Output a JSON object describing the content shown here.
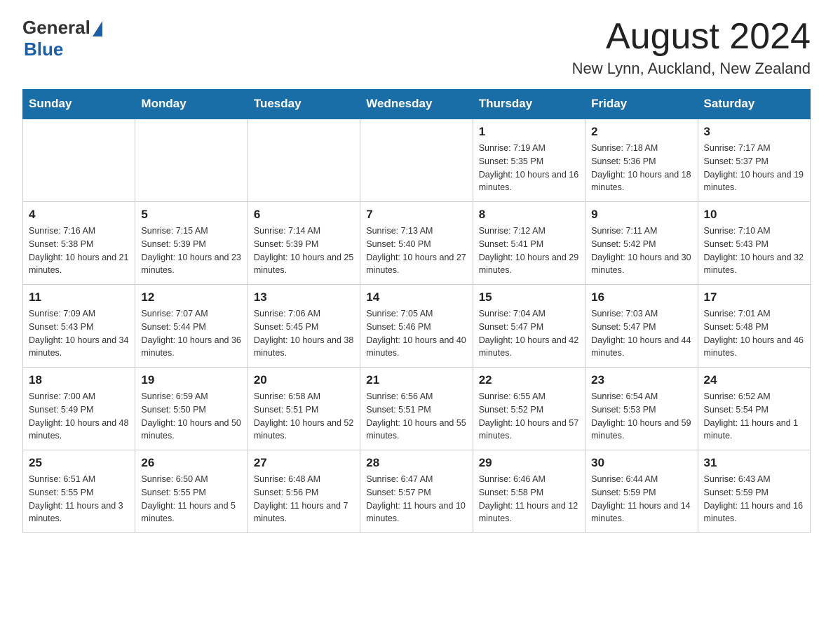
{
  "header": {
    "logo_general": "General",
    "logo_blue": "Blue",
    "month_title": "August 2024",
    "location": "New Lynn, Auckland, New Zealand"
  },
  "days_of_week": [
    "Sunday",
    "Monday",
    "Tuesday",
    "Wednesday",
    "Thursday",
    "Friday",
    "Saturday"
  ],
  "weeks": [
    [
      {
        "day": "",
        "info": ""
      },
      {
        "day": "",
        "info": ""
      },
      {
        "day": "",
        "info": ""
      },
      {
        "day": "",
        "info": ""
      },
      {
        "day": "1",
        "info": "Sunrise: 7:19 AM\nSunset: 5:35 PM\nDaylight: 10 hours and 16 minutes."
      },
      {
        "day": "2",
        "info": "Sunrise: 7:18 AM\nSunset: 5:36 PM\nDaylight: 10 hours and 18 minutes."
      },
      {
        "day": "3",
        "info": "Sunrise: 7:17 AM\nSunset: 5:37 PM\nDaylight: 10 hours and 19 minutes."
      }
    ],
    [
      {
        "day": "4",
        "info": "Sunrise: 7:16 AM\nSunset: 5:38 PM\nDaylight: 10 hours and 21 minutes."
      },
      {
        "day": "5",
        "info": "Sunrise: 7:15 AM\nSunset: 5:39 PM\nDaylight: 10 hours and 23 minutes."
      },
      {
        "day": "6",
        "info": "Sunrise: 7:14 AM\nSunset: 5:39 PM\nDaylight: 10 hours and 25 minutes."
      },
      {
        "day": "7",
        "info": "Sunrise: 7:13 AM\nSunset: 5:40 PM\nDaylight: 10 hours and 27 minutes."
      },
      {
        "day": "8",
        "info": "Sunrise: 7:12 AM\nSunset: 5:41 PM\nDaylight: 10 hours and 29 minutes."
      },
      {
        "day": "9",
        "info": "Sunrise: 7:11 AM\nSunset: 5:42 PM\nDaylight: 10 hours and 30 minutes."
      },
      {
        "day": "10",
        "info": "Sunrise: 7:10 AM\nSunset: 5:43 PM\nDaylight: 10 hours and 32 minutes."
      }
    ],
    [
      {
        "day": "11",
        "info": "Sunrise: 7:09 AM\nSunset: 5:43 PM\nDaylight: 10 hours and 34 minutes."
      },
      {
        "day": "12",
        "info": "Sunrise: 7:07 AM\nSunset: 5:44 PM\nDaylight: 10 hours and 36 minutes."
      },
      {
        "day": "13",
        "info": "Sunrise: 7:06 AM\nSunset: 5:45 PM\nDaylight: 10 hours and 38 minutes."
      },
      {
        "day": "14",
        "info": "Sunrise: 7:05 AM\nSunset: 5:46 PM\nDaylight: 10 hours and 40 minutes."
      },
      {
        "day": "15",
        "info": "Sunrise: 7:04 AM\nSunset: 5:47 PM\nDaylight: 10 hours and 42 minutes."
      },
      {
        "day": "16",
        "info": "Sunrise: 7:03 AM\nSunset: 5:47 PM\nDaylight: 10 hours and 44 minutes."
      },
      {
        "day": "17",
        "info": "Sunrise: 7:01 AM\nSunset: 5:48 PM\nDaylight: 10 hours and 46 minutes."
      }
    ],
    [
      {
        "day": "18",
        "info": "Sunrise: 7:00 AM\nSunset: 5:49 PM\nDaylight: 10 hours and 48 minutes."
      },
      {
        "day": "19",
        "info": "Sunrise: 6:59 AM\nSunset: 5:50 PM\nDaylight: 10 hours and 50 minutes."
      },
      {
        "day": "20",
        "info": "Sunrise: 6:58 AM\nSunset: 5:51 PM\nDaylight: 10 hours and 52 minutes."
      },
      {
        "day": "21",
        "info": "Sunrise: 6:56 AM\nSunset: 5:51 PM\nDaylight: 10 hours and 55 minutes."
      },
      {
        "day": "22",
        "info": "Sunrise: 6:55 AM\nSunset: 5:52 PM\nDaylight: 10 hours and 57 minutes."
      },
      {
        "day": "23",
        "info": "Sunrise: 6:54 AM\nSunset: 5:53 PM\nDaylight: 10 hours and 59 minutes."
      },
      {
        "day": "24",
        "info": "Sunrise: 6:52 AM\nSunset: 5:54 PM\nDaylight: 11 hours and 1 minute."
      }
    ],
    [
      {
        "day": "25",
        "info": "Sunrise: 6:51 AM\nSunset: 5:55 PM\nDaylight: 11 hours and 3 minutes."
      },
      {
        "day": "26",
        "info": "Sunrise: 6:50 AM\nSunset: 5:55 PM\nDaylight: 11 hours and 5 minutes."
      },
      {
        "day": "27",
        "info": "Sunrise: 6:48 AM\nSunset: 5:56 PM\nDaylight: 11 hours and 7 minutes."
      },
      {
        "day": "28",
        "info": "Sunrise: 6:47 AM\nSunset: 5:57 PM\nDaylight: 11 hours and 10 minutes."
      },
      {
        "day": "29",
        "info": "Sunrise: 6:46 AM\nSunset: 5:58 PM\nDaylight: 11 hours and 12 minutes."
      },
      {
        "day": "30",
        "info": "Sunrise: 6:44 AM\nSunset: 5:59 PM\nDaylight: 11 hours and 14 minutes."
      },
      {
        "day": "31",
        "info": "Sunrise: 6:43 AM\nSunset: 5:59 PM\nDaylight: 11 hours and 16 minutes."
      }
    ]
  ]
}
